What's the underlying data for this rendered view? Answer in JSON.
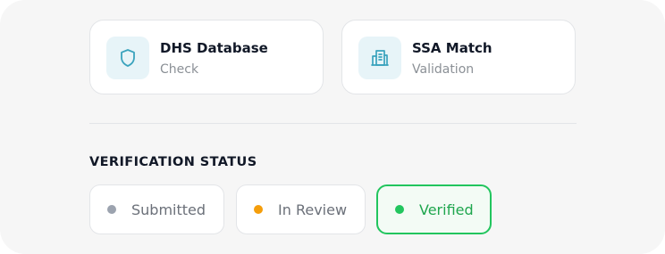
{
  "cards": [
    {
      "title": "DHS Database",
      "subtitle": "Check",
      "icon": "shield-icon"
    },
    {
      "title": "SSA Match",
      "subtitle": "Validation",
      "icon": "building-icon"
    }
  ],
  "verification": {
    "heading": "VERIFICATION STATUS",
    "statuses": [
      {
        "label": "Submitted",
        "color": "#9ca3af"
      },
      {
        "label": "In Review",
        "color": "#f59e0b"
      },
      {
        "label": "Verified",
        "color": "#22c55e",
        "active": true
      }
    ]
  },
  "colors": {
    "accent": "#22c55e",
    "icon": "#3aa3bd",
    "icon_bg": "#e7f4f8"
  }
}
